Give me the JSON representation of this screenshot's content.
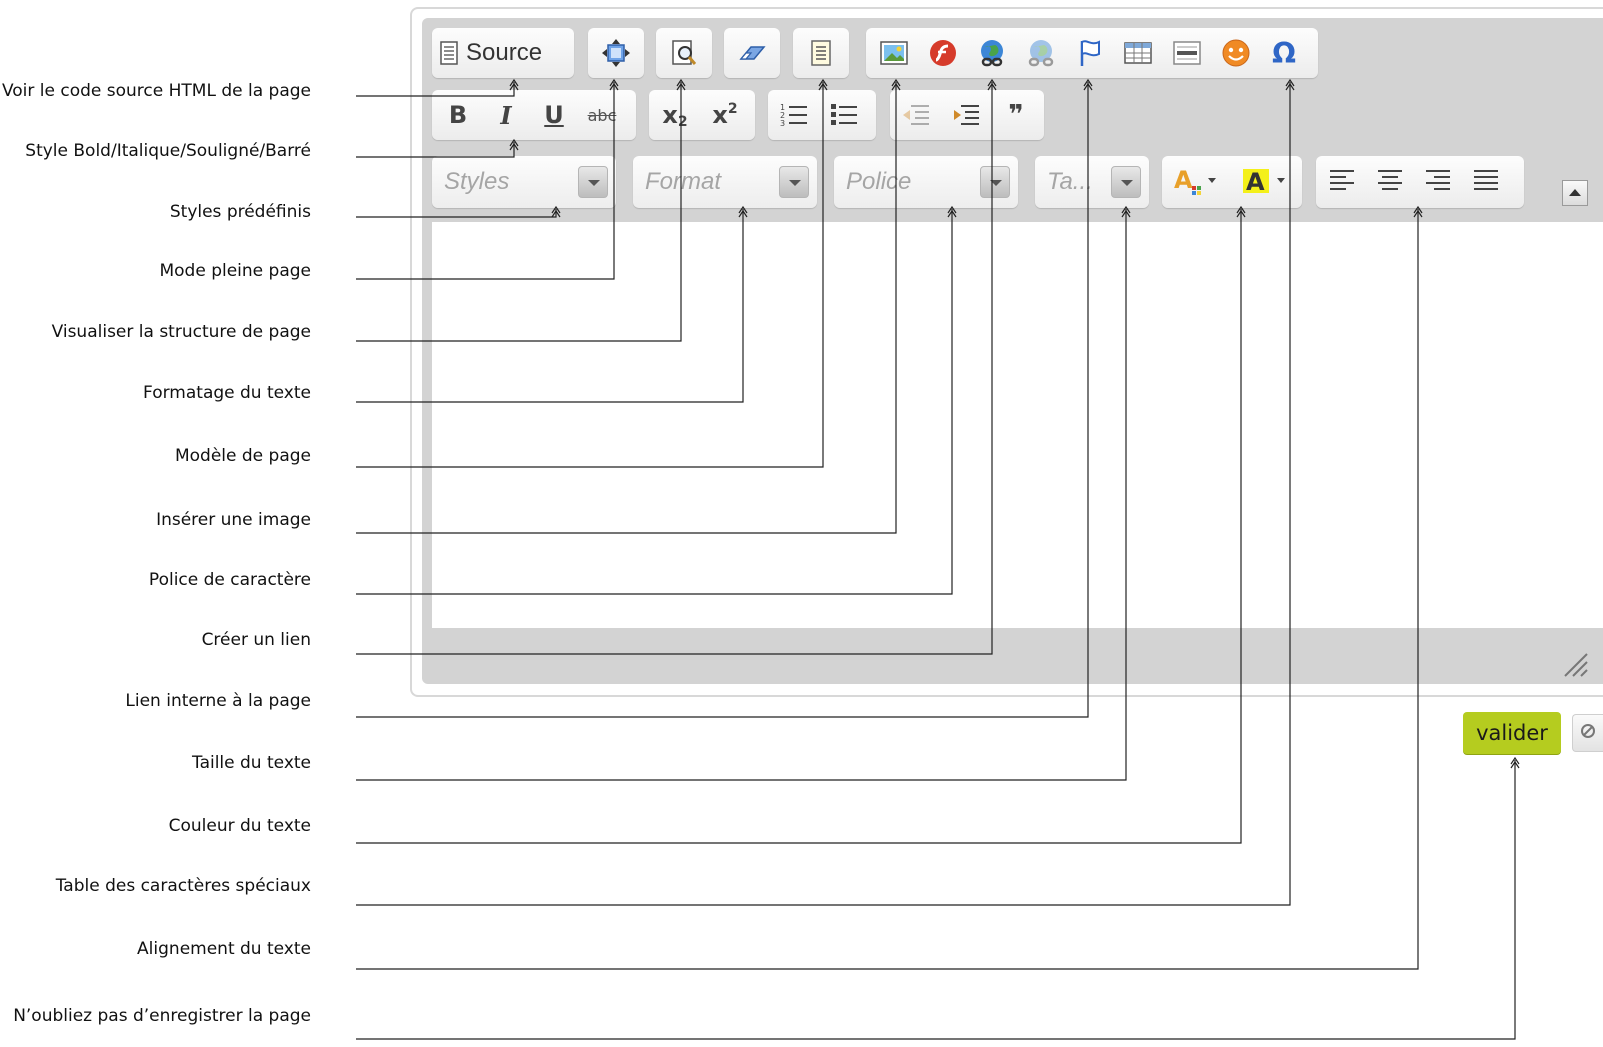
{
  "annotations": [
    "Voir le code source HTML de la page",
    "Style Bold/Italique/Souligné/Barré",
    "Styles prédéfinis",
    "Mode pleine page",
    "Visualiser la structure de page",
    "Formatage du texte",
    "Modèle de page",
    "Insérer une image",
    "Police de caractère",
    "Créer un lien",
    "Lien interne à la page",
    "Taille du texte",
    "Couleur du texte",
    "Table des caractères spéciaux",
    "Alignement du texte",
    "N’oubliez pas d’enregistrer la page"
  ],
  "toolbar": {
    "source_label": "Source",
    "bold": "B",
    "italic": "I",
    "underline": "U",
    "strike": "abc",
    "subscript": "x",
    "subscript_sub": "2",
    "superscript": "x",
    "superscript_sup": "2",
    "blockquote": "❞",
    "special_char": "Ω"
  },
  "combos": {
    "styles": "Styles",
    "format": "Format",
    "font": "Police",
    "size": "Ta..."
  },
  "actions": {
    "submit": "valider"
  },
  "icons": {
    "source": "document-icon",
    "fullscreen": "maximize-icon",
    "show_blocks": "magnifier-document-icon",
    "remove_format": "eraser-icon",
    "templates": "template-icon",
    "image": "image-icon",
    "flash": "flash-icon",
    "link": "globe-link-icon",
    "unlink": "globe-unlink-icon",
    "anchor": "flag-icon",
    "table": "table-icon",
    "hr": "horizontal-rule-icon",
    "smiley": "smiley-icon",
    "special_char": "omega-icon",
    "text_color": "text-color-icon",
    "bg_color": "background-color-icon",
    "collapse": "collapse-toolbar-icon",
    "cancel": "cancel-icon",
    "resize": "resize-handle-icon"
  },
  "colors": {
    "submit_bg": "#b5cc1f",
    "chrome": "#d3d3d3",
    "accent_blue": "#2f66c6",
    "flash_red": "#d63b2b",
    "smiley_orange": "#f08a24",
    "highlight_yellow": "#f4f01a"
  }
}
